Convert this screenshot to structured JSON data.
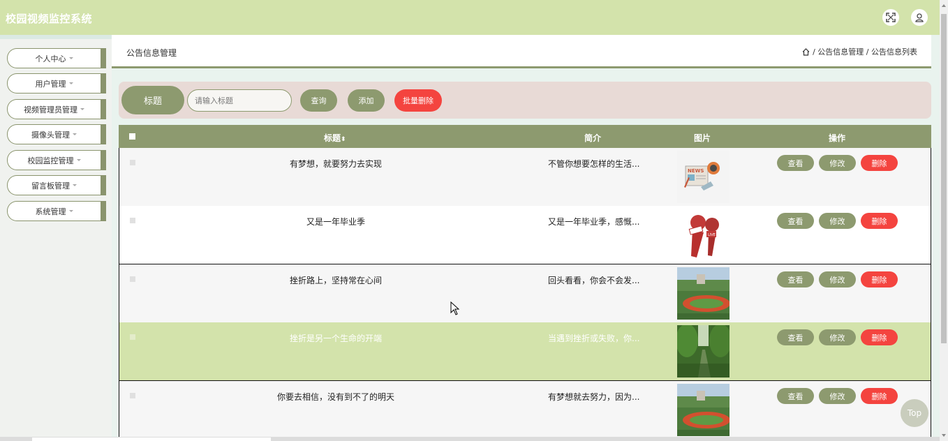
{
  "app": {
    "title": "校园视频监控系统"
  },
  "topbar": {
    "fullscreen_icon": "fullscreen-icon",
    "user_icon": "user-icon"
  },
  "sidebar": {
    "items": [
      {
        "label": "个人中心"
      },
      {
        "label": "用户管理"
      },
      {
        "label": "视频管理员管理"
      },
      {
        "label": "摄像头管理"
      },
      {
        "label": "校园监控管理"
      },
      {
        "label": "留言板管理"
      },
      {
        "label": "系统管理"
      }
    ]
  },
  "page": {
    "title": "公告信息管理",
    "breadcrumb": {
      "home_icon": "home-icon",
      "sep": "/",
      "level1": "公告信息管理",
      "level2": "公告信息列表"
    }
  },
  "search": {
    "label": "标题",
    "placeholder": "请输入标题",
    "query_button": "查询",
    "add_button": "添加",
    "batch_delete_button": "批量删除"
  },
  "table": {
    "headers": {
      "title": "标题",
      "sort_mark": "⬍",
      "intro": "简介",
      "image": "图片",
      "actions": "操作"
    },
    "actions": {
      "view": "查看",
      "edit": "修改",
      "delete": "删除"
    },
    "rows": [
      {
        "title": "有梦想，就要努力去实现",
        "intro": "不管你想要怎样的生活...",
        "image": "news-illustration"
      },
      {
        "title": "又是一年毕业季",
        "intro": "又是一年毕业季，感慨...",
        "image": "microphones-illustration"
      },
      {
        "title": "挫折路上，坚持常在心间",
        "intro": "回头看看，你会不会发...",
        "image": "campus-track-photo"
      },
      {
        "title": "挫折是另一个生命的开端",
        "intro": "当遇到挫折或失败，你...",
        "image": "tree-avenue-photo"
      },
      {
        "title": "你要去相信，没有到不了的明天",
        "intro": "有梦想就去努力，因为...",
        "image": "campus-track-photo"
      }
    ],
    "highlight_row": 3
  },
  "scroll_top": {
    "label": "Top"
  },
  "colors": {
    "topbar_bg": "#d3e3ab",
    "accent": "#8d9a6f",
    "danger": "#f4443f",
    "search_bg": "#e8dad6",
    "highlight_row": "#d3e3ab"
  }
}
